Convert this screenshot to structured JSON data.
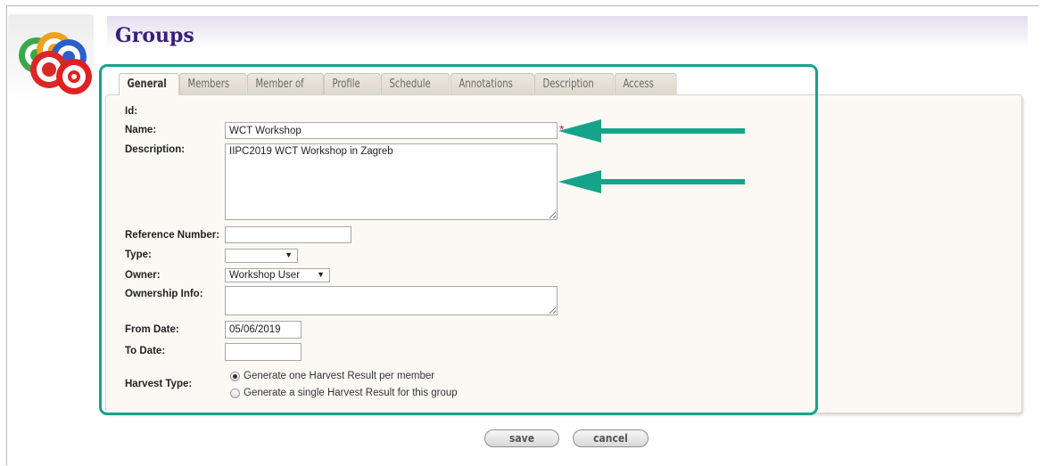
{
  "page": {
    "title": "Groups"
  },
  "tabs": [
    {
      "label": "General",
      "active": true
    },
    {
      "label": "Members",
      "active": false
    },
    {
      "label": "Member of",
      "active": false
    },
    {
      "label": "Profile",
      "active": false
    },
    {
      "label": "Schedule",
      "active": false
    },
    {
      "label": "Annotations",
      "active": false
    },
    {
      "label": "Description",
      "active": false
    },
    {
      "label": "Access",
      "active": false
    }
  ],
  "form": {
    "id_label": "Id:",
    "name_label": "Name:",
    "name_value": "WCT Workshop",
    "required_marker": "*",
    "description_label": "Description:",
    "description_value": "IIPC2019 WCT Workshop in Zagreb",
    "reference_number_label": "Reference Number:",
    "reference_number_value": "",
    "type_label": "Type:",
    "type_value": "",
    "owner_label": "Owner:",
    "owner_value": "Workshop User",
    "ownership_info_label": "Ownership Info:",
    "ownership_info_value": "",
    "from_date_label": "From Date:",
    "from_date_value": "05/06/2019",
    "to_date_label": "To Date:",
    "to_date_value": "",
    "harvest_type_label": "Harvest Type:",
    "harvest_options": [
      {
        "label": "Generate one Harvest Result per member",
        "checked": true
      },
      {
        "label": "Generate a single Harvest Result for this group",
        "checked": false
      }
    ]
  },
  "buttons": {
    "save": "save",
    "cancel": "cancel"
  },
  "colors": {
    "title": "#3a1f79",
    "annotation": "#15a389",
    "required": "#d02020"
  }
}
